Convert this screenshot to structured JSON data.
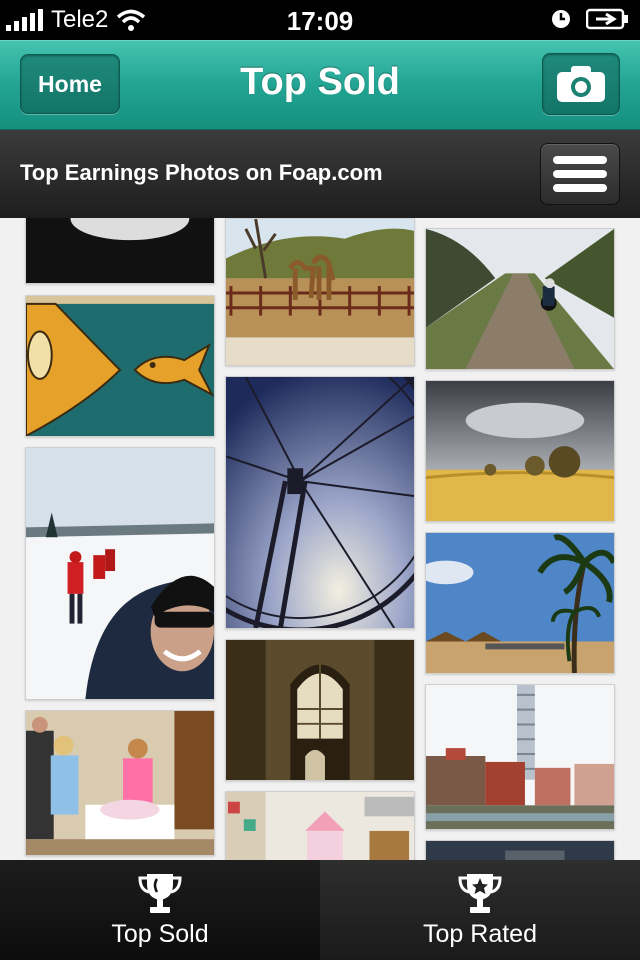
{
  "status_bar": {
    "carrier": "Tele2",
    "time": "17:09"
  },
  "nav": {
    "home_label": "Home",
    "title": "Top Sold"
  },
  "sub_header": {
    "title": "Top Earnings Photos on Foap.com"
  },
  "photos": [
    "photo-dark-top",
    "photo-fish-painting",
    "photo-ski-selfie",
    "photo-family-party",
    "photo-camels",
    "photo-ferris-wheel",
    "photo-church-window",
    "photo-kids-room",
    "photo-dirt-road",
    "photo-wheat-field",
    "photo-palm-beach",
    "photo-twisting-tower",
    "photo-partial-bottom"
  ],
  "tabs": [
    {
      "label": "Top Sold",
      "icon": "trophy-icon",
      "active": true
    },
    {
      "label": "Top Rated",
      "icon": "trophy-star-icon",
      "active": false
    }
  ],
  "colors": {
    "nav_teal": "#23a493",
    "tab_bg": "#111111"
  }
}
